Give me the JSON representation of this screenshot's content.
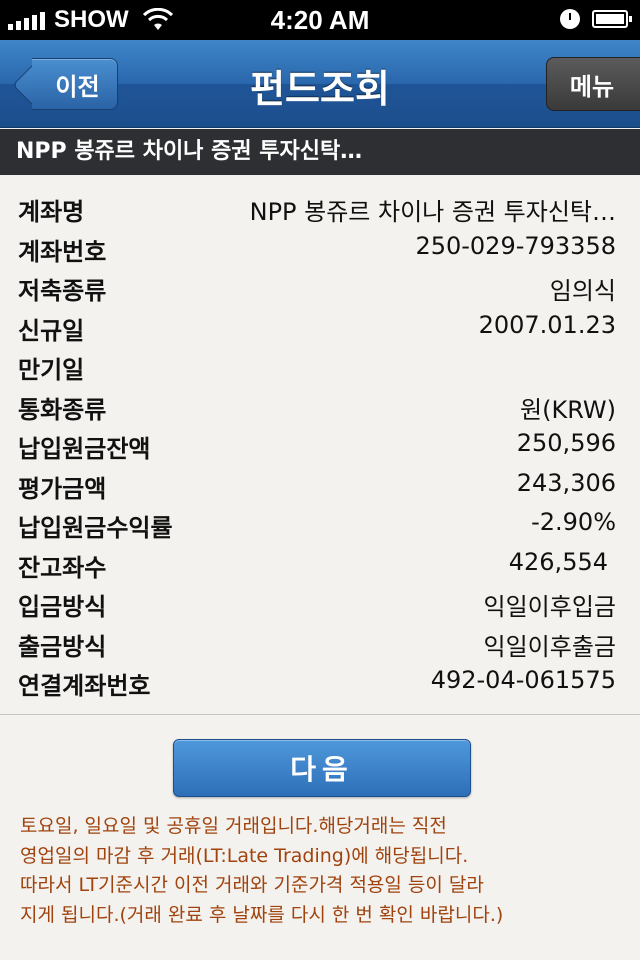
{
  "status_bar": {
    "carrier": "SHOW",
    "time": "4:20 AM"
  },
  "nav": {
    "back_label": "이전",
    "title": "펀드조회",
    "menu_label": "메뉴"
  },
  "fund_header": "NPP 봉쥬르 차이나 증권 투자신탁…",
  "rows": [
    {
      "label": "계좌명",
      "value": "NPP 봉쥬르 차이나 증권 투자신탁…"
    },
    {
      "label": "계좌번호",
      "value": "250-029-793358"
    },
    {
      "label": "저축종류",
      "value": "임의식"
    },
    {
      "label": "신규일",
      "value": "2007.01.23"
    },
    {
      "label": "만기일",
      "value": ""
    },
    {
      "label": "통화종류",
      "value": "원(KRW)"
    },
    {
      "label": "납입원금잔액",
      "value": "250,596"
    },
    {
      "label": "평가금액",
      "value": "243,306"
    },
    {
      "label": "납입원금수익률",
      "value": "-2.90%"
    },
    {
      "label": "잔고좌수",
      "value": "426,554"
    },
    {
      "label": "입금방식",
      "value": "익일이후입금"
    },
    {
      "label": "출금방식",
      "value": "익일이후출금"
    },
    {
      "label": "연결계좌번호",
      "value": "492-04-061575"
    }
  ],
  "next_button": "다음",
  "notice": [
    "토요일, 일요일 및 공휴일 거래입니다.해당거래는 직전",
    "영업일의 마감 후 거래(LT:Late Trading)에 해당됩니다.",
    "따라서 LT기준시간 이전 거래와 기준가격 적용일 등이 달라",
    "지게 됩니다.(거래 완료 후 날짜를 다시 한 번 확인 바랍니다.)"
  ],
  "colors": {
    "nav_blue": "#2a67ad",
    "notice_text": "#a0430e",
    "background": "#f4f2ee"
  }
}
